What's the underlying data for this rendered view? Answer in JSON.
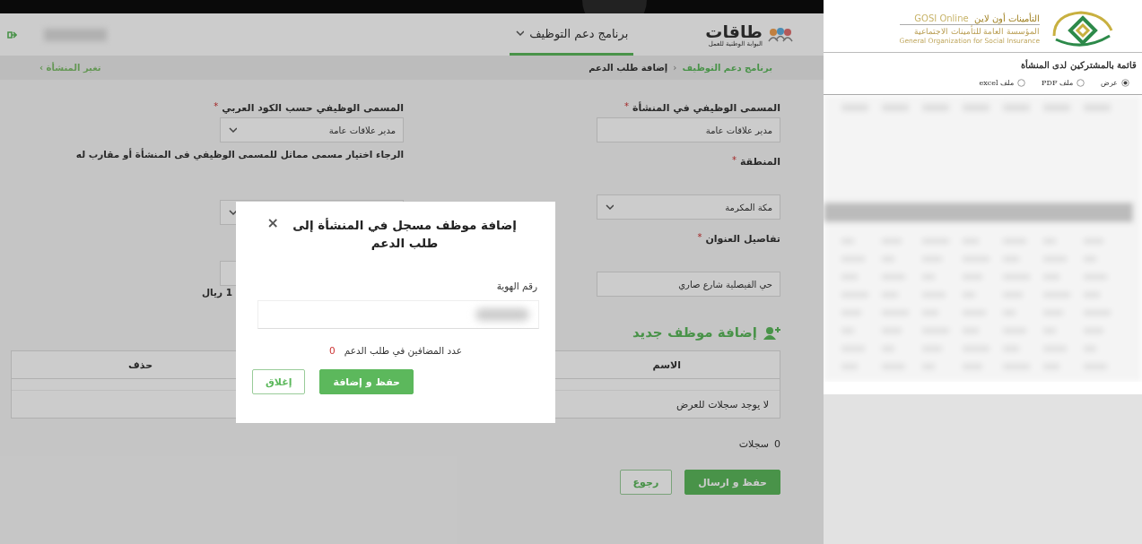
{
  "taqat": {
    "logo": {
      "name": "طاقات",
      "tagline": "البوابة الوطنية للعمل"
    },
    "nav": [
      {
        "label": "برنامج دعم التوظيف",
        "selected": true
      }
    ],
    "breadcrumb": [
      {
        "label": "برنامج دعم التوظيف",
        "kind": "link"
      },
      {
        "label": "‹",
        "kind": "separator"
      },
      {
        "label": "إضافة طلب الدعم",
        "kind": "current"
      }
    ],
    "change_establishment": "تغير المنشأة ›",
    "required_symbol": "*",
    "form_right": [
      {
        "kind": "select_text",
        "label": "المسمى الوظيفي في المنشأة",
        "required": true,
        "value": "مدير علاقات عامة"
      },
      {
        "kind": "select",
        "label": "المنطقة",
        "required": true,
        "value": "مكة المكرمة"
      },
      {
        "kind": "text",
        "label": "تفاصيل العنوان",
        "required": true,
        "value": "حي الفيصلية شارع صاري"
      }
    ],
    "form_left": {
      "label": "المسمى الوظيفي حسب الكود العربي",
      "required": true,
      "value": "مدير علاقات عامة",
      "help": "الرجاء اختيار مسمى مماثل للمسمى الوظيفي فى المنشأة أو مقارب له",
      "note": "1 ريال"
    },
    "section_title": "إضافة موظف جديد",
    "table": {
      "columns": [
        {
          "label": "الاسم"
        },
        {
          "label": "حذف"
        }
      ],
      "empty_text": "لا يوجد سجلات للعرض"
    },
    "records_count": "0",
    "records_label": "سجلات",
    "buttons": [
      {
        "label": "حفظ و ارسال",
        "kind": "primary"
      },
      {
        "label": "رجوع",
        "kind": "secondary"
      }
    ]
  },
  "modal": {
    "title": "إضافة موظف مسجل في المنشأة إلى طلب الدعم",
    "close": "×",
    "field_label": "رقم الهوية",
    "count_label": "عدد المضافين في طلب الدعم",
    "count": "0",
    "buttons": [
      {
        "label": "حفظ و إضافة",
        "kind": "primary"
      },
      {
        "label": "إغلاق",
        "kind": "secondary"
      }
    ]
  },
  "gosi": {
    "brand_ar": "التأمينات أون لاين",
    "brand_en": "GOSI Online",
    "org_ar": "المؤسسة العامة للتأمينات الاجتماعية",
    "org_en": "General Organization for Social Insurance",
    "heading": "قائمة بالمشتركين لدى المنشأة",
    "export_options": [
      {
        "label": "عرض",
        "selected": true
      },
      {
        "label": "ملف PDF",
        "selected": false
      },
      {
        "label": "ملف excel",
        "selected": false
      }
    ]
  }
}
